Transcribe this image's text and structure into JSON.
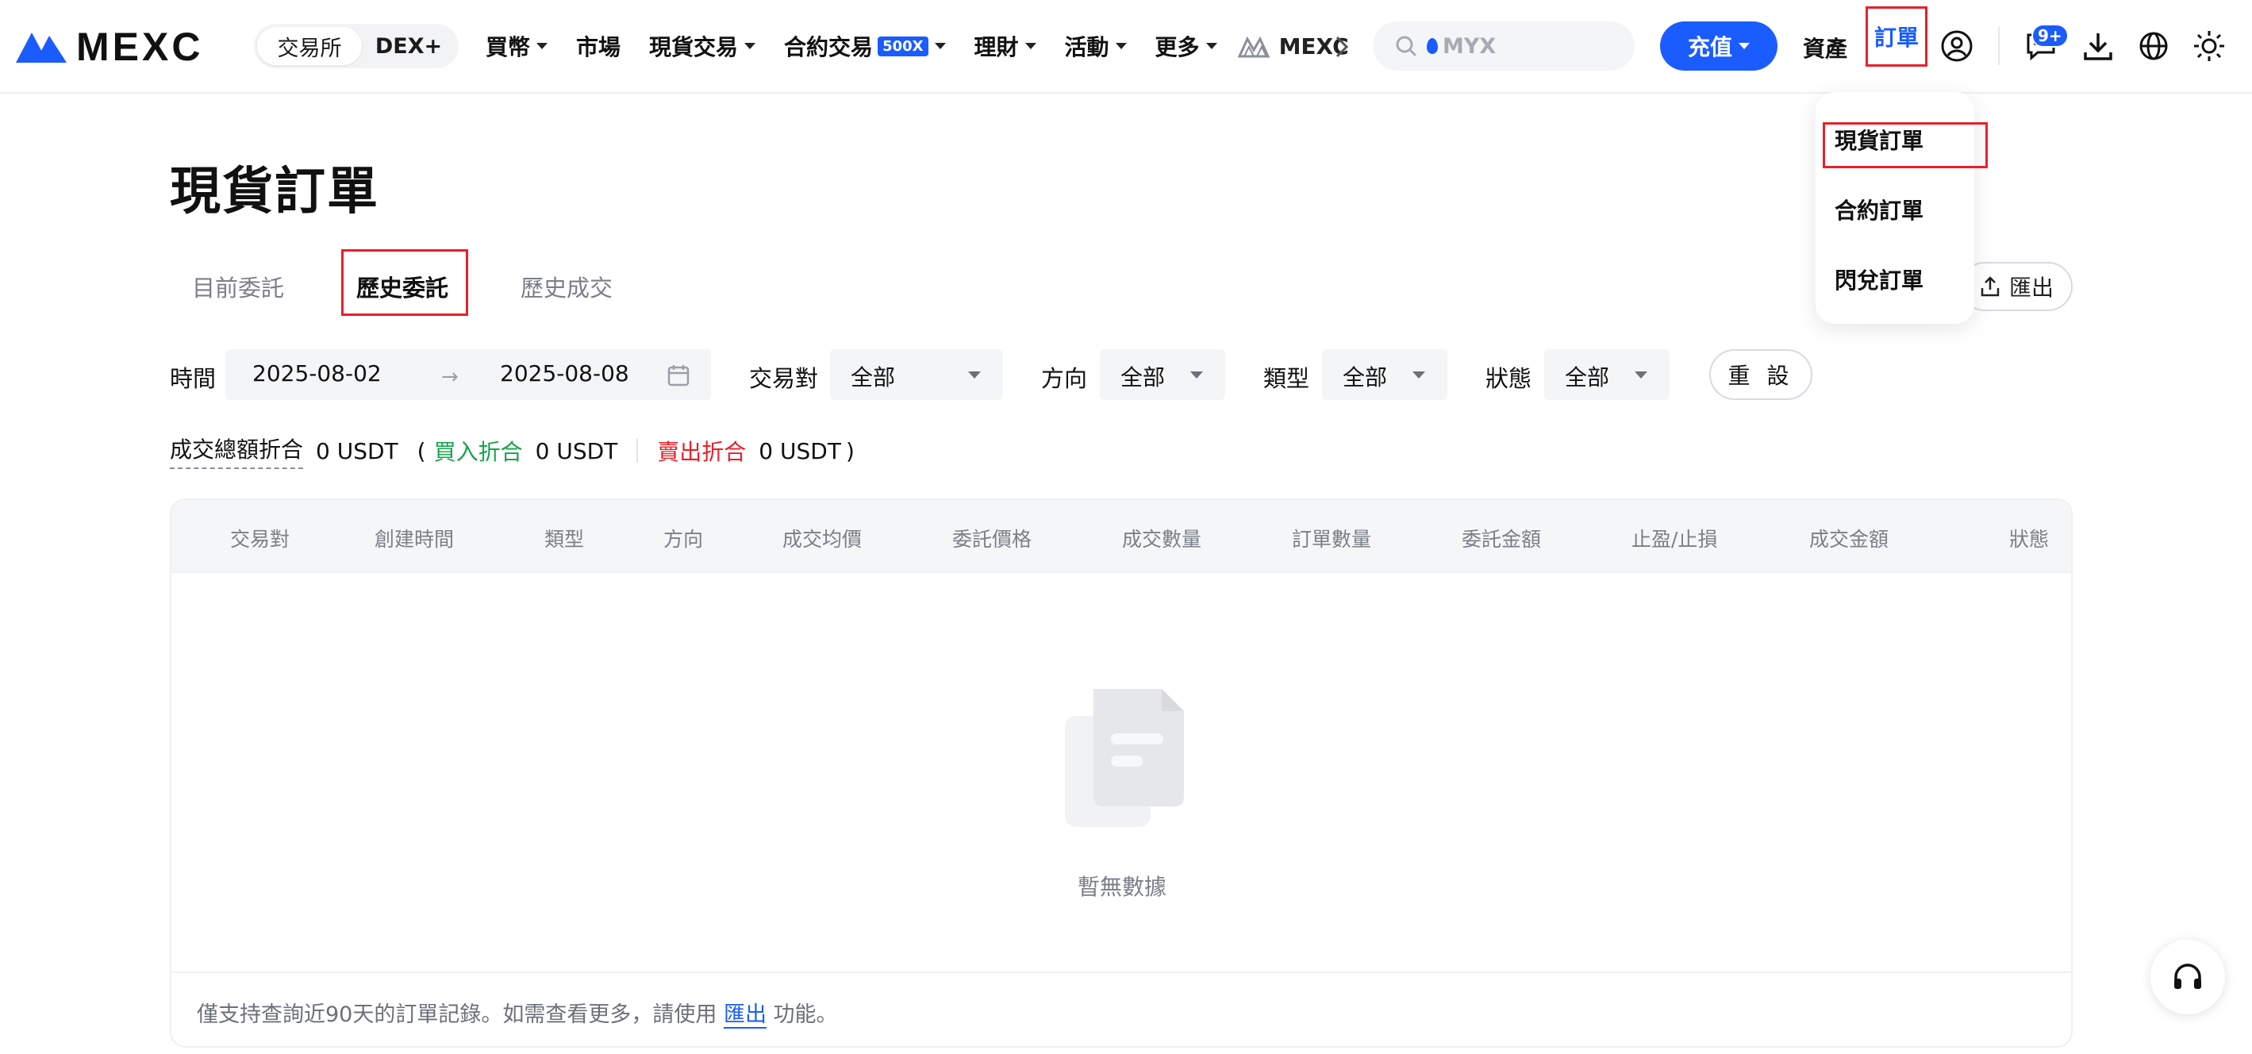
{
  "brand": {
    "name": "MEXC",
    "accent": "#1b5cff",
    "highlight": "#e8202a"
  },
  "exchange_toggle": {
    "exchange": "交易所",
    "dex": "DEX+"
  },
  "nav": {
    "buy": "買幣",
    "market": "市場",
    "spot": "現貨交易",
    "futures": "合約交易",
    "futures_badge": "500X",
    "earn": "理財",
    "events": "活動",
    "more": "更多",
    "ticker": "MEXC"
  },
  "search": {
    "placeholder": "MYX"
  },
  "header_actions": {
    "deposit": "充值",
    "assets": "資產",
    "orders": "訂單",
    "notification_count": "9+"
  },
  "order_menu": {
    "items": [
      "現貨訂單",
      "合約訂單",
      "閃兌訂單"
    ]
  },
  "page": {
    "title": "現貨訂單"
  },
  "tabs": {
    "open": "目前委託",
    "history": "歷史委託",
    "trades": "歷史成交"
  },
  "export": {
    "label": "匯出"
  },
  "filters": {
    "time_label": "時間",
    "date_from": "2025-08-02",
    "date_to": "2025-08-08",
    "pair_label": "交易對",
    "pair_value": "全部",
    "side_label": "方向",
    "side_value": "全部",
    "type_label": "類型",
    "type_value": "全部",
    "status_label": "狀態",
    "status_value": "全部",
    "reset": "重 設"
  },
  "summary": {
    "total_label": "成交總額折合",
    "total_value": "0 USDT",
    "open_paren": "(",
    "buy_label": "買入折合",
    "buy_value": "0 USDT",
    "sell_label": "賣出折合",
    "sell_value": "0 USDT",
    "close_paren": ")"
  },
  "table": {
    "columns": [
      "交易對",
      "創建時間",
      "類型",
      "方向",
      "成交均價",
      "委託價格",
      "成交數量",
      "訂單數量",
      "委託金額",
      "止盈/止損",
      "成交金額",
      "狀態"
    ],
    "empty_text": "暫無數據",
    "footer_note_prefix": "僅支持查詢近90天的訂單記錄。如需查看更多，請使用",
    "footer_note_link": "匯出",
    "footer_note_suffix": "功能。"
  },
  "icons": {
    "logo": "mexc-logo-icon",
    "search": "search-icon",
    "user": "user-icon",
    "chat": "chat-icon",
    "download": "download-icon",
    "globe": "globe-icon",
    "theme": "sun-icon",
    "support": "headset-icon"
  }
}
